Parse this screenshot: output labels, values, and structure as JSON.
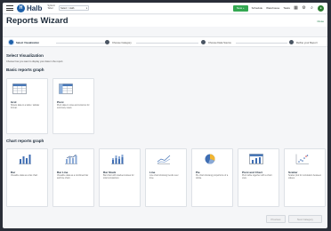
{
  "header": {
    "logo_letter": "H",
    "logo_text": "Halb",
    "system_label": "System",
    "system_value": "Tabel",
    "env_value": "Select > Halb",
    "new_button": "New +",
    "links": [
      "Schedule",
      "Warehouse",
      "Tasks"
    ]
  },
  "page": {
    "title": "Reports Wizard",
    "close": "Close"
  },
  "steps": [
    {
      "label": "Select Visualization",
      "active": true
    },
    {
      "label": "Choose Category",
      "active": false
    },
    {
      "label": "Choose Data Source",
      "active": false
    },
    {
      "label": "Define your Report",
      "active": false
    }
  ],
  "select_heading": "Select Visualization",
  "select_description": "Choose how you want to display your data in the report.",
  "basic_heading": "Basic reports graph",
  "basic_cards": [
    {
      "title": "Grid",
      "desc": "Shows data in a table / tabular format.",
      "icon": "grid-icon"
    },
    {
      "title": "Pivot",
      "desc": "Pivot data in rows and columns for summary views.",
      "icon": "pivot-icon"
    }
  ],
  "chart_heading": "Chart reports graph",
  "chart_cards": [
    {
      "title": "Bar",
      "desc": "Visualize data as a bar chart.",
      "icon": "bar-chart-icon"
    },
    {
      "title": "Bar Line",
      "desc": "Visualize data as a combined bar and line chart.",
      "icon": "bar-line-chart-icon"
    },
    {
      "title": "Bar Stack",
      "desc": "Bar chart with stacked values for total comparison.",
      "icon": "bar-stack-chart-icon"
    },
    {
      "title": "Line",
      "desc": "Line chart showing trends over time.",
      "icon": "line-chart-icon"
    },
    {
      "title": "Pie",
      "desc": "Pie chart showing proportions of a whole.",
      "icon": "pie-chart-icon"
    },
    {
      "title": "Pivot and Chart",
      "desc": "Pivot table together with a chart view.",
      "icon": "pivot-chart-icon"
    },
    {
      "title": "Scatter",
      "desc": "Scatter plot for correlation between values.",
      "icon": "scatter-chart-icon"
    }
  ],
  "footer": {
    "previous": "Previous",
    "next": "Next Category"
  },
  "colors": {
    "accent": "#1d5fa8",
    "new_button": "#33a852",
    "avatar": "#2e7d32"
  }
}
